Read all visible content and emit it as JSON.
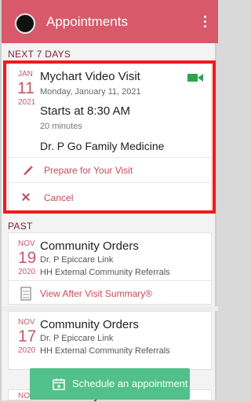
{
  "app": {
    "title": "Appointments"
  },
  "sections": {
    "next": "NEXT 7 DAYS",
    "past": "PAST"
  },
  "upcoming": {
    "month": "JAN",
    "day": "11",
    "year": "2021",
    "title": "Mychart Video Visit",
    "date": "Monday, January 11, 2021",
    "starts": "Starts at 8:30 AM",
    "duration": "20 minutes",
    "department": "Dr. P Go Family Medicine",
    "prepare": "Prepare for Your Visit",
    "cancel": "Cancel"
  },
  "past": [
    {
      "month": "NOV",
      "day": "19",
      "year": "2020",
      "title": "Community Orders",
      "provider": "Dr. P Epiccare Link",
      "dept": "HH External Community Referrals",
      "link": "View After Visit Summary®"
    },
    {
      "month": "NOV",
      "day": "17",
      "year": "2020",
      "title": "Community Orders",
      "provider": "Dr. P Epiccare Link",
      "dept": "HH External Community Referrals"
    },
    {
      "month": "NOV",
      "title": "Community Orders"
    }
  ],
  "schedule": "Schedule an appointment",
  "colors": {
    "appbar": "#d85a6a",
    "accent": "#c64a5b",
    "green": "#52c08a",
    "highlight": "#f31a1a"
  },
  "icons": [
    "avatar",
    "overflow-menu-icon",
    "video-camera-icon",
    "pen-icon",
    "close-icon",
    "document-icon",
    "calendar-icon"
  ]
}
